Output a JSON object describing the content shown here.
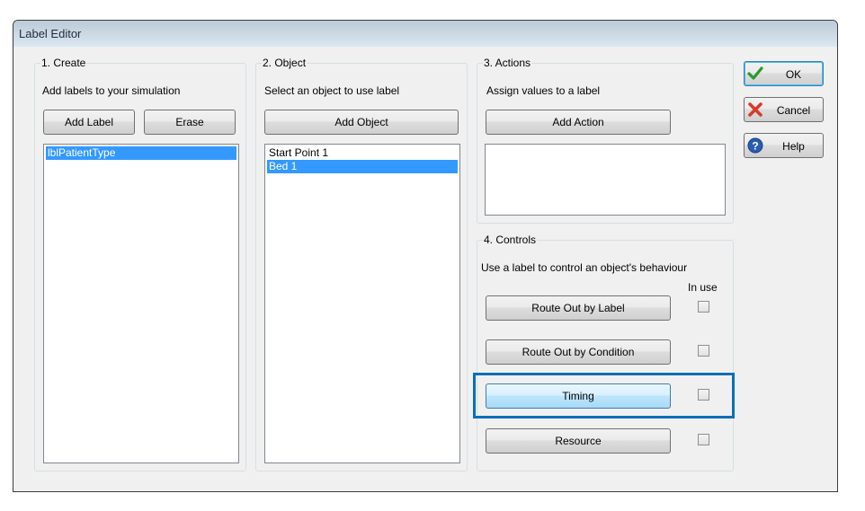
{
  "window": {
    "title": "Label Editor"
  },
  "create": {
    "legend": "1. Create",
    "description": "Add labels to your simulation",
    "add_label": "Add Label",
    "erase": "Erase",
    "labels": [
      {
        "text": "lblPatientType",
        "selected": true
      }
    ]
  },
  "object": {
    "legend": "2. Object",
    "description": "Select an object to use label",
    "add_object": "Add Object",
    "objects": [
      {
        "text": "Start Point 1",
        "selected": false
      },
      {
        "text": "Bed 1",
        "selected": true
      }
    ]
  },
  "actions": {
    "legend": "3. Actions",
    "description": "Assign values to a label",
    "add_action": "Add Action",
    "items": []
  },
  "controls": {
    "legend": "4. Controls",
    "description": "Use a label to control an object's behaviour",
    "in_use_header": "In use",
    "rows": [
      {
        "label": "Route Out by Label",
        "in_use": false,
        "highlighted": false
      },
      {
        "label": "Route Out by Condition",
        "in_use": false,
        "highlighted": false
      },
      {
        "label": "Timing",
        "in_use": false,
        "highlighted": true
      },
      {
        "label": "Resource",
        "in_use": false,
        "highlighted": false
      }
    ]
  },
  "side_buttons": {
    "ok": {
      "label": "OK",
      "icon": "check-icon"
    },
    "cancel": {
      "label": "Cancel",
      "icon": "x-icon"
    },
    "help": {
      "label": "Help",
      "icon": "question-icon"
    }
  },
  "colors": {
    "selection": "#3399ff",
    "highlight_border": "#0a6fb8"
  }
}
